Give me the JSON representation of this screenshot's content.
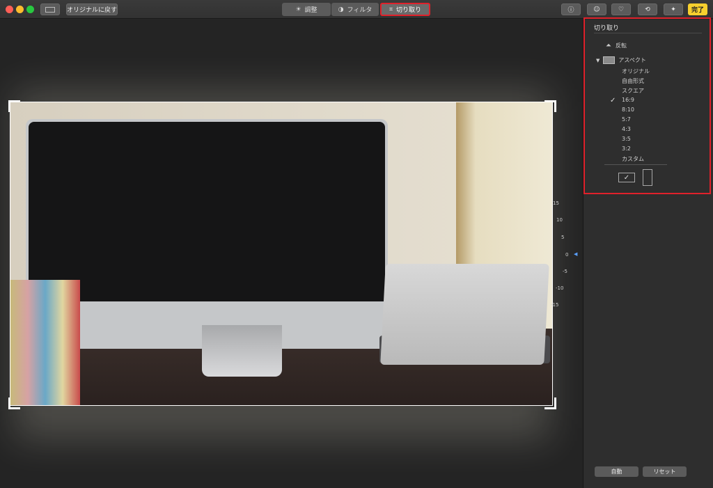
{
  "toolbar": {
    "revert_label": "オリジナルに戻す",
    "tabs": [
      {
        "label": "調整",
        "icon": "sun-icon"
      },
      {
        "label": "フィルタ",
        "icon": "filter-icon"
      },
      {
        "label": "切り取り",
        "icon": "crop-icon"
      }
    ],
    "right_icons": [
      "info-icon",
      "face-icon",
      "heart-icon",
      "rotate-icon",
      "magic-wand-icon"
    ],
    "done_label": "完了"
  },
  "sidebar": {
    "title": "切り取り",
    "flip_label": "反転",
    "aspect_label": "アスペクト",
    "aspect_options": [
      "オリジナル",
      "自由形式",
      "スクエア",
      "16:9",
      "8:10",
      "5:7",
      "4:3",
      "3:5",
      "3:2",
      "カスタム"
    ],
    "selected_option": "16:9",
    "check_glyph": "✓",
    "auto_label": "自動",
    "reset_label": "リセット"
  },
  "dial": {
    "ticks": [
      "15",
      "10",
      "5",
      "0",
      "-5",
      "-10",
      "-15"
    ],
    "value": 0
  },
  "colors": {
    "accent_highlight": "#e0212b",
    "done_button": "#f7d02e"
  }
}
